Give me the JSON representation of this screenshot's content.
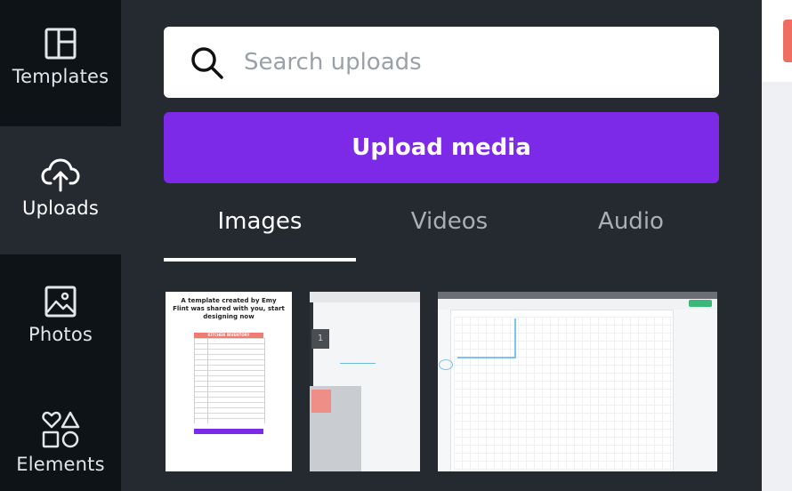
{
  "rail": {
    "items": [
      {
        "label": "Templates",
        "icon": "templates-icon",
        "active": false
      },
      {
        "label": "Uploads",
        "icon": "cloud-upload-icon",
        "active": true
      },
      {
        "label": "Photos",
        "icon": "image-icon",
        "active": false
      },
      {
        "label": "Elements",
        "icon": "shapes-icon",
        "active": false
      }
    ]
  },
  "search": {
    "placeholder": "Search uploads",
    "value": ""
  },
  "upload_button": {
    "label": "Upload media"
  },
  "tabs": [
    {
      "label": "Images",
      "active": true
    },
    {
      "label": "Videos",
      "active": false
    },
    {
      "label": "Audio",
      "active": false
    }
  ],
  "thumbnails": [
    {
      "title": "A template created by Emy Flint was shared with you, start designing now",
      "inventory_label": "KITCHEN INVENTORY"
    },
    {
      "digit": "1"
    },
    {}
  ],
  "colors": {
    "panel_bg": "#252a31",
    "rail_bg": "#0e1318",
    "accent": "#7d2ae8",
    "tab_inactive": "#a9afb6"
  }
}
